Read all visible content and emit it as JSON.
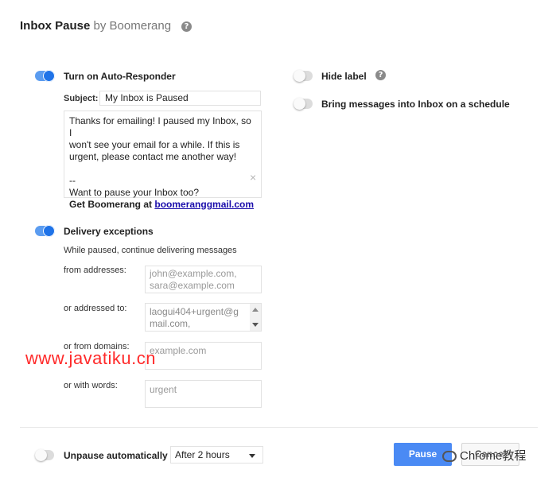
{
  "header": {
    "title": "Inbox Pause",
    "subtitle": " by Boomerang",
    "help_icon": "?"
  },
  "auto_responder": {
    "label": "Turn on Auto-Responder",
    "enabled": true,
    "subject_label": "Subject:",
    "subject_value": "My Inbox is Paused",
    "message_lines": [
      "Thanks for emailing! I paused my Inbox, so I",
      "won't see your email for a while. If this is",
      "urgent, please contact me another way!",
      "",
      "--",
      "Want to pause your Inbox too?"
    ],
    "signature_prefix": "Get Boomerang at ",
    "signature_link": "boomeranggmail.com",
    "remove_icon": "×"
  },
  "options": {
    "hide_label": "Hide label",
    "hide_label_enabled": false,
    "help_icon": "?",
    "schedule_label": "Bring messages into Inbox on a schedule",
    "schedule_enabled": false
  },
  "delivery_exceptions": {
    "label": "Delivery exceptions",
    "enabled": true,
    "description": "While paused, continue delivering messages",
    "from_addresses_label": "from addresses:",
    "from_addresses_placeholder_1": "john@example.com,",
    "from_addresses_placeholder_2": "sara@example.com",
    "addressed_to_label": "or addressed to:",
    "addressed_to_value_1": "laogui404+urgent@g",
    "addressed_to_value_2": "mail.com,",
    "from_domains_label": "or from domains:",
    "from_domains_placeholder": "example.com",
    "with_words_label": "or with words:",
    "with_words_placeholder": "urgent"
  },
  "footer": {
    "unpause_label": "Unpause automatically",
    "unpause_enabled": false,
    "unpause_select_value": "After 2 hours",
    "pause_button": "Pause",
    "cancel_button": "Cancel"
  },
  "watermark": {
    "text": "www.javatiku.cn",
    "badge_text": "Chrome教程"
  },
  "colors": {
    "accent": "#4285f4",
    "toggle_on": "#1f73e8",
    "watermark": "#ff2a2a"
  }
}
